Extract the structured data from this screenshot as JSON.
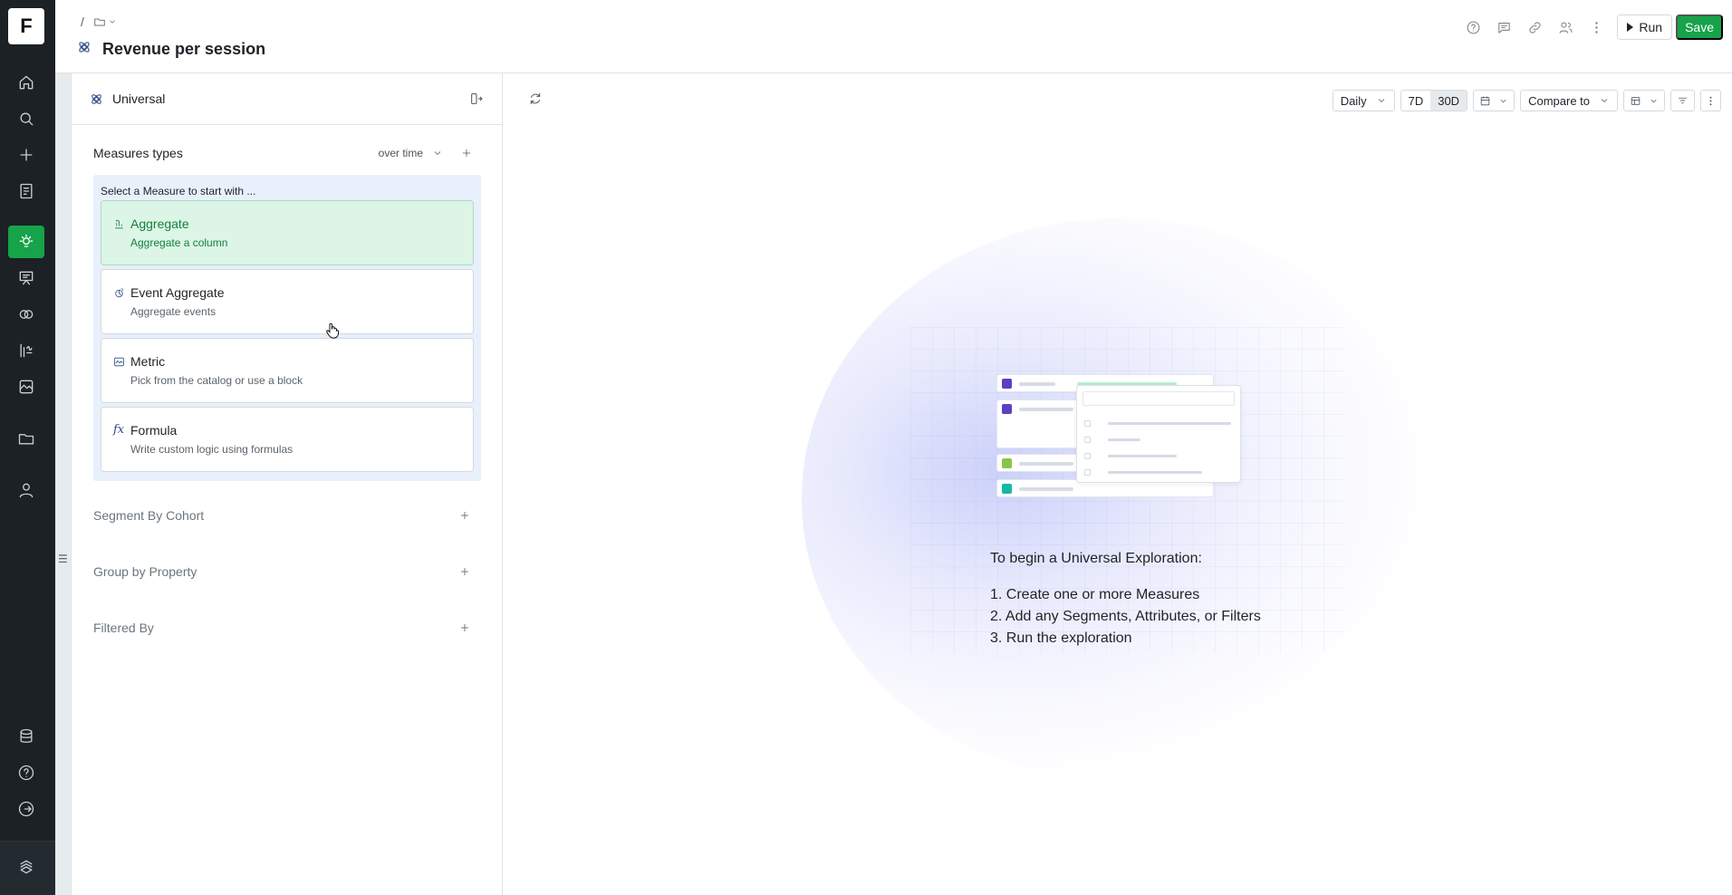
{
  "rail": {
    "logo_letter": "F",
    "icons": [
      "home-icon",
      "search-icon",
      "plus-icon",
      "notebook-icon",
      "lightbulb-icon",
      "presentation-icon",
      "circles-icon",
      "function-chart-icon",
      "image-chart-icon",
      "folder-icon",
      "user-icon",
      "database-icon",
      "help-icon",
      "logout-icon",
      "brand-icon"
    ],
    "active": "lightbulb-icon"
  },
  "header": {
    "breadcrumb_sep": "/",
    "title": "Revenue per session",
    "run_label": "Run",
    "save_label": "Save"
  },
  "panel": {
    "mode_label": "Universal",
    "measures": {
      "title": "Measures types",
      "over_time_label": "over time",
      "hint": "Select a Measure to start with ...",
      "cards": [
        {
          "title": "Aggregate",
          "subtitle": "Aggregate a column",
          "icon": "aggregate-icon",
          "selected": true
        },
        {
          "title": "Event Aggregate",
          "subtitle": "Aggregate events",
          "icon": "event-aggregate-icon",
          "selected": false
        },
        {
          "title": "Metric",
          "subtitle": "Pick from the catalog or use a block",
          "icon": "metric-icon",
          "selected": false
        },
        {
          "title": "Formula",
          "subtitle": "Write custom logic using formulas",
          "icon": "fx-icon",
          "fx_glyph": "fx",
          "selected": false
        }
      ]
    },
    "sections": [
      {
        "title": "Segment By Cohort"
      },
      {
        "title": "Group by Property"
      },
      {
        "title": "Filtered By"
      }
    ]
  },
  "toolbar": {
    "granularity": "Daily",
    "ranges": [
      "7D",
      "30D"
    ],
    "active_range": "30D",
    "compare_label": "Compare to"
  },
  "empty_state": {
    "title": "To begin a Universal Exploration:",
    "steps": [
      "1. Create one or more Measures",
      "2. Add any Segments, Attributes, or Filters",
      "3. Run the exploration"
    ]
  },
  "colors": {
    "rail_bg": "#1b2125",
    "accent_green": "#16a34a",
    "selected_card_bg": "#dcf5e6",
    "picker_bg": "#e8f0fb",
    "icon_blue": "#2f4a85"
  }
}
